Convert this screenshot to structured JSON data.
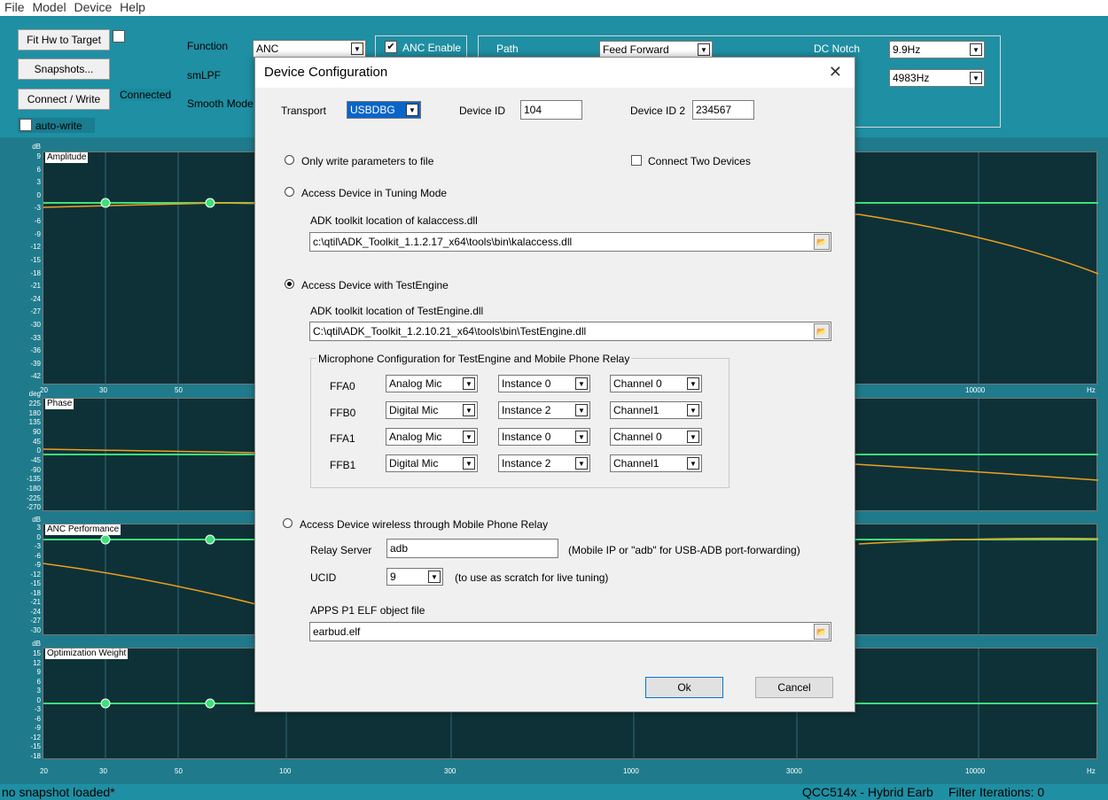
{
  "menu": [
    "File",
    "Model",
    "Device",
    "Help"
  ],
  "top": {
    "fit_btn": "Fit Hw to Target",
    "snapshots_btn": "Snapshots...",
    "connect_btn": "Connect / Write",
    "connected_label": "Connected",
    "autowrite_label": "auto-write",
    "function_label": "Function",
    "function_value": "ANC",
    "smlpf_label": "smLPF",
    "smooth_label": "Smooth Mode",
    "anc_enable_label": "ANC Enable",
    "path_label": "Path",
    "path_value": "Feed Forward",
    "dcnotch_label": "DC Notch",
    "dcnotch_value": "9.9Hz",
    "freq2_value": "4983Hz"
  },
  "plots": {
    "amplitude": {
      "title": "Amplitude",
      "unit": "dB",
      "ticks": [
        "9",
        "6",
        "3",
        "0",
        "-3",
        "-6",
        "-9",
        "-12",
        "-15",
        "-18",
        "-21",
        "-24",
        "-27",
        "-30",
        "-33",
        "-36",
        "-39",
        "-42"
      ]
    },
    "phase": {
      "title": "Phase",
      "unit": "deg",
      "ticks": [
        "225",
        "180",
        "135",
        "90",
        "45",
        "0",
        "-45",
        "-90",
        "-135",
        "-180",
        "-225",
        "-270"
      ]
    },
    "anc": {
      "title": "ANC Performance",
      "unit": "dB",
      "ticks": [
        "3",
        "0",
        "-3",
        "-6",
        "-9",
        "-12",
        "-15",
        "-18",
        "-21",
        "-24",
        "-27",
        "-30"
      ]
    },
    "opt": {
      "title": "Optimization Weight",
      "unit": "dB",
      "ticks": [
        "15",
        "12",
        "9",
        "6",
        "3",
        "0",
        "-3",
        "-6",
        "-9",
        "-12",
        "-15",
        "-18"
      ]
    },
    "xticks": [
      "20",
      "30",
      "50",
      "100",
      "300",
      "1000",
      "3000",
      "10000",
      "Hz"
    ]
  },
  "status": {
    "left": "no snapshot loaded*",
    "device": "QCC514x - Hybrid Earb",
    "iterations": "Filter Iterations: 0"
  },
  "dialog": {
    "title": "Device Configuration",
    "transport_label": "Transport",
    "transport_value": "USBDBG",
    "deviceid_label": "Device ID",
    "deviceid_value": "104",
    "deviceid2_label": "Device ID 2",
    "deviceid2_value": "234567",
    "opt_file": "Only write parameters to file",
    "two_devices": "Connect Two Devices",
    "opt_tuning": "Access Device in Tuning Mode",
    "kal_label": "ADK toolkit location of kalaccess.dll",
    "kal_value": "c:\\qtil\\ADK_Toolkit_1.1.2.17_x64\\tools\\bin\\kalaccess.dll",
    "opt_testengine": "Access Device with TestEngine",
    "te_label": "ADK toolkit location of TestEngine.dll",
    "te_value": "C:\\qtil\\ADK_Toolkit_1.2.10.21_x64\\tools\\bin\\TestEngine.dll",
    "mic_group": "Microphone Configuration for TestEngine and Mobile Phone Relay",
    "mics": [
      {
        "name": "FFA0",
        "type": "Analog Mic",
        "instance": "Instance 0",
        "channel": "Channel 0"
      },
      {
        "name": "FFB0",
        "type": "Digital Mic",
        "instance": "Instance 2",
        "channel": "Channel1"
      },
      {
        "name": "FFA1",
        "type": "Analog Mic",
        "instance": "Instance 0",
        "channel": "Channel 0"
      },
      {
        "name": "FFB1",
        "type": "Digital Mic",
        "instance": "Instance 2",
        "channel": "Channel1"
      }
    ],
    "opt_relay": "Access Device wireless through Mobile Phone Relay",
    "relay_label": "Relay Server",
    "relay_value": "adb",
    "relay_hint": "(Mobile IP or \"adb\" for USB-ADB port-forwarding)",
    "ucid_label": "UCID",
    "ucid_value": "9",
    "ucid_hint": "(to use as scratch for live tuning)",
    "elf_label": "APPS P1 ELF object file",
    "elf_value": "earbud.elf",
    "ok": "Ok",
    "cancel": "Cancel"
  },
  "colors": {
    "plot_bg": "#0e3137",
    "green": "#3ee07a",
    "orange": "#f0a020"
  }
}
